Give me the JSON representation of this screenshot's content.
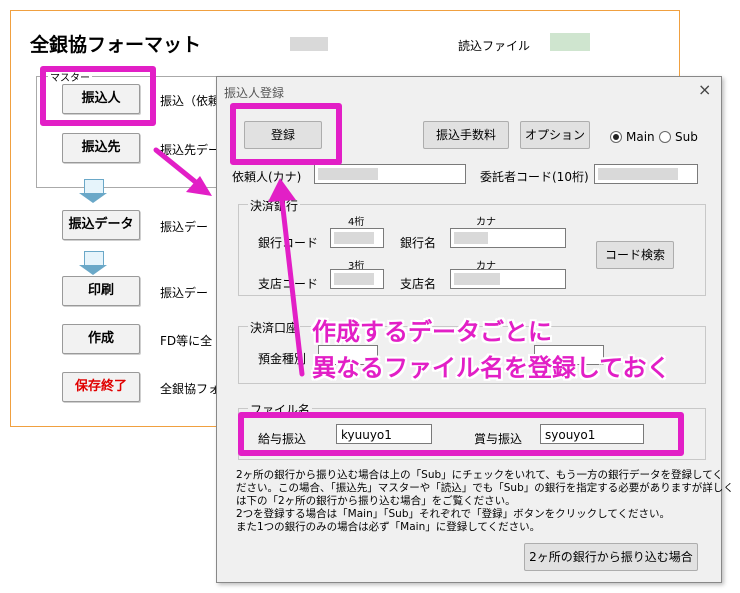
{
  "sheet": {
    "title": "全銀協フォーマット",
    "read_file_label": "読込ファイル",
    "master_group_label": "マスター",
    "rows": [
      {
        "button": "振込人",
        "desc": "振込（依頼"
      },
      {
        "button": "振込先",
        "desc": "振込先デー"
      },
      {
        "button": "振込データ",
        "desc": "振込デー"
      },
      {
        "button": "印刷",
        "desc": "振込デー"
      },
      {
        "button": "作成",
        "desc": "FD等に全"
      },
      {
        "button": "保存終了",
        "desc": "全銀協フォ",
        "color": "#e00000"
      }
    ]
  },
  "dialog": {
    "title": "振込人登録",
    "close_symbol": "×",
    "register_button": "登録",
    "fee_button": "振込手数料",
    "option_button": "オプション",
    "radio_main": "Main",
    "radio_sub": "Sub",
    "radio_selected": "Main",
    "requester_kana_label": "依頼人(カナ)",
    "consignor_code_label": "委託者コード(10桁)",
    "bank_group_label": "決済銀行",
    "digits4_hint": "4桁",
    "kana_hint1": "カナ",
    "bank_code_label": "銀行コード",
    "bank_name_label": "銀行名",
    "digits3_hint": "3桁",
    "kana_hint2": "カナ",
    "branch_code_label": "支店コード",
    "branch_name_label": "支店名",
    "code_search_button": "コード検索",
    "account_group_label": "決済口座",
    "deposit_type_label": "預金種別",
    "file_group_label": "ファイル名",
    "salary_label": "給与振込",
    "salary_value": "kyuuyo1",
    "bonus_label": "賞与振込",
    "bonus_value": "syouyo1",
    "notes": [
      "2ヶ所の銀行から振り込む場合は上の「Sub」にチェックをいれて、もう一方の銀行データを登録してく",
      "ださい。この場合、「振込先」マスターや「読込」でも「Sub」の銀行を指定する必要がありますが詳しく",
      "は下の「2ヶ所の銀行から振り込む場合」をご覧ください。",
      "2つを登録する場合は「Main」「Sub」それぞれで「登録」ボタンをクリックしてください。",
      "また1つの銀行のみの場合は必ず「Main」に登録してください。"
    ],
    "two_banks_button": "2ヶ所の銀行から振り込む場合"
  },
  "annotation": {
    "line1": "作成するデータごとに",
    "line2": "異なるファイル名を登録しておく",
    "color": "#e21fc6"
  }
}
